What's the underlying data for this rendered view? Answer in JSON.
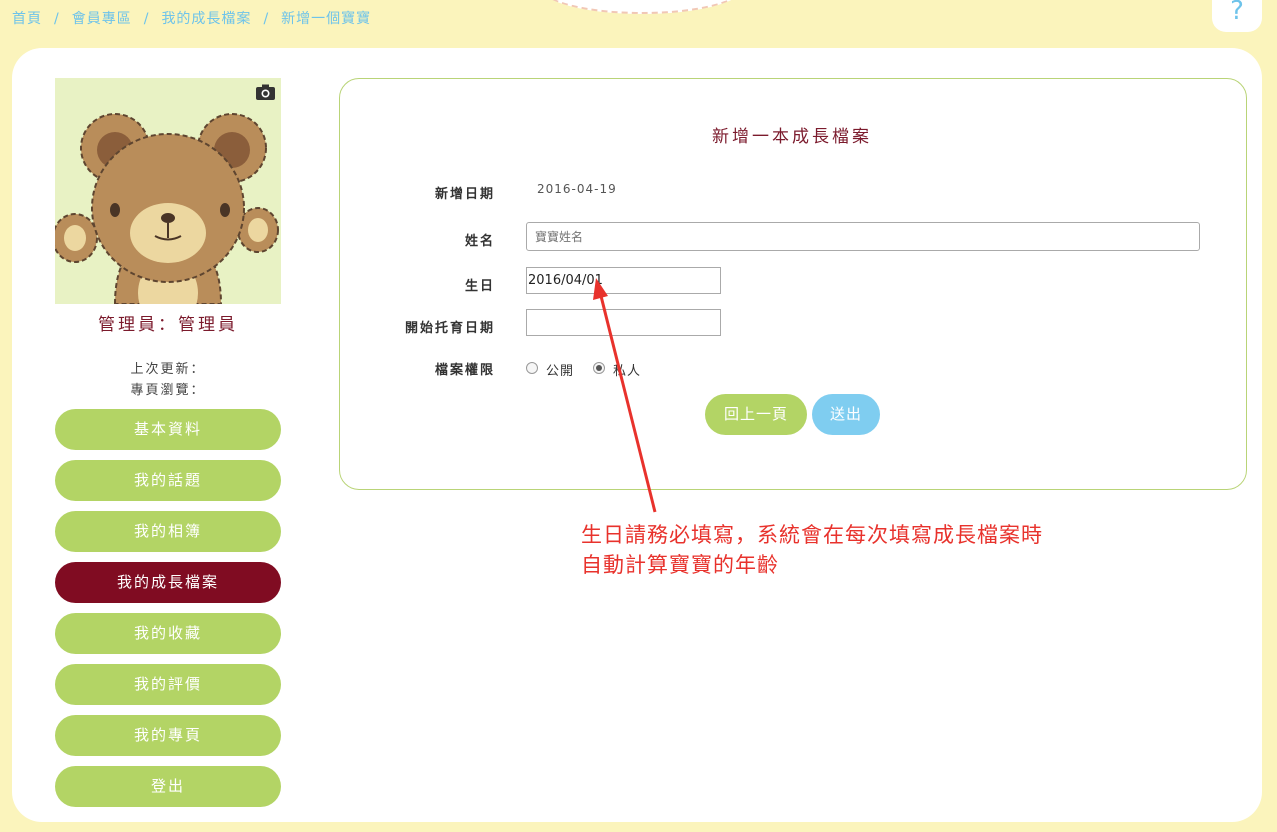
{
  "breadcrumb": [
    "首頁",
    "會員專區",
    "我的成長檔案",
    "新增一個寶寶"
  ],
  "breadcrumb_sep": "/",
  "help": "?",
  "sidebar": {
    "admin_name": "管理員：管理員",
    "last_update_label": "上次更新：",
    "page_views_label": "專頁瀏覽：",
    "menu": [
      {
        "label": "基本資料",
        "active": false
      },
      {
        "label": "我的話題",
        "active": false
      },
      {
        "label": "我的相簿",
        "active": false
      },
      {
        "label": "我的成長檔案",
        "active": true
      },
      {
        "label": "我的收藏",
        "active": false
      },
      {
        "label": "我的評價",
        "active": false
      },
      {
        "label": "我的專頁",
        "active": false
      },
      {
        "label": "登出",
        "active": false
      }
    ]
  },
  "form": {
    "title": "新增一本成長檔案",
    "created_date_label": "新增日期",
    "created_date_value": "2016-04-19",
    "name_label": "姓名",
    "name_placeholder": "寶寶姓名",
    "birthday_label": "生日",
    "birthday_value": "2016/04/01",
    "care_start_label": "開始托育日期",
    "care_start_value": "",
    "privacy_label": "檔案權限",
    "privacy_options": [
      {
        "label": "公開",
        "checked": false
      },
      {
        "label": "私人",
        "checked": true
      }
    ],
    "back_button": "回上一頁",
    "submit_button": "送出"
  },
  "annotation": {
    "line1": "生日請務必填寫，系統會在每次填寫成長檔案時",
    "line2": "自動計算寶寶的年齡"
  },
  "colors": {
    "background": "#fbf4bc",
    "accent_green": "#b3d465",
    "accent_maroon": "#800c22",
    "accent_blue": "#7fcdf0",
    "annotation_red": "#e8322c"
  }
}
